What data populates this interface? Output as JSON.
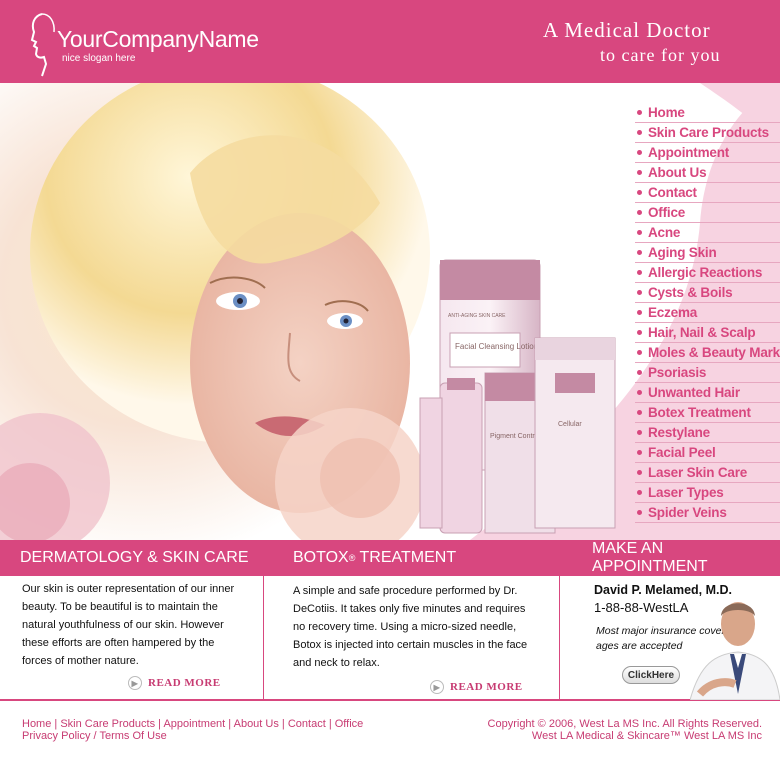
{
  "header": {
    "company_name": "YourCompanyName",
    "slogan": "nice slogan here",
    "tagline_line1": "A Medical Doctor",
    "tagline_line2": "to care for you"
  },
  "nav": {
    "items": [
      "Home",
      "Skin Care Products",
      "Appointment",
      "About Us",
      "Contact",
      "Office",
      "Acne",
      "Aging Skin",
      "Allergic Reactions",
      "Cysts & Boils",
      "Eczema",
      "Hair, Nail & Scalp",
      "Moles & Beauty Marks",
      "Psoriasis",
      "Unwanted Hair",
      "Botex Treatment",
      "Restylane",
      "Facial Peel",
      "Laser Skin Care",
      "Laser Types",
      "Spider Veins"
    ]
  },
  "hero": {
    "product_labels": [
      "ANTI-AGING SKIN CARE",
      "Facial Cleansing Lotion",
      "Pigment Control",
      "Cellular"
    ]
  },
  "sections": {
    "dermatology": {
      "title": "DERMATOLOGY & SKIN CARE",
      "text": "Our skin is outer representation of our inner beauty. To be beautiful is to maintain the natural youthfulness of our skin. However these efforts are often hampered by the forces of mother nature.",
      "read_more": "READ MORE"
    },
    "botox": {
      "title_main": "BOTOX",
      "title_sup": "®",
      "title_rest": " TREATMENT",
      "text": "A simple and safe procedure performed by Dr. DeCotiis. It takes only five minutes and requires no recovery time. Using a micro-sized needle, Botox is injected into certain muscles in the face and neck to relax.",
      "read_more": "READ MORE"
    },
    "appointment": {
      "title": "MAKE AN APPOINTMENT",
      "doctor_name": "David P. Melamed, M.D.",
      "phone": "1-88-88-WestLA",
      "insurance": "Most major insurance cover-ages are accepted",
      "button": "ClickHere"
    }
  },
  "footer": {
    "links": [
      "Home",
      "Skin Care Products",
      "Appointment",
      "About Us",
      "Contact",
      "Office"
    ],
    "links2": [
      "Privacy Policy",
      "Terms Of Use"
    ],
    "copyright": "Copyright © 2006, West La MS Inc. All Rights Reserved.",
    "trademark": "West LA Medical & Skincare™ West LA MS Inc"
  },
  "colors": {
    "brand_pink": "#d8477f",
    "light_pink": "#f7d3e1"
  }
}
